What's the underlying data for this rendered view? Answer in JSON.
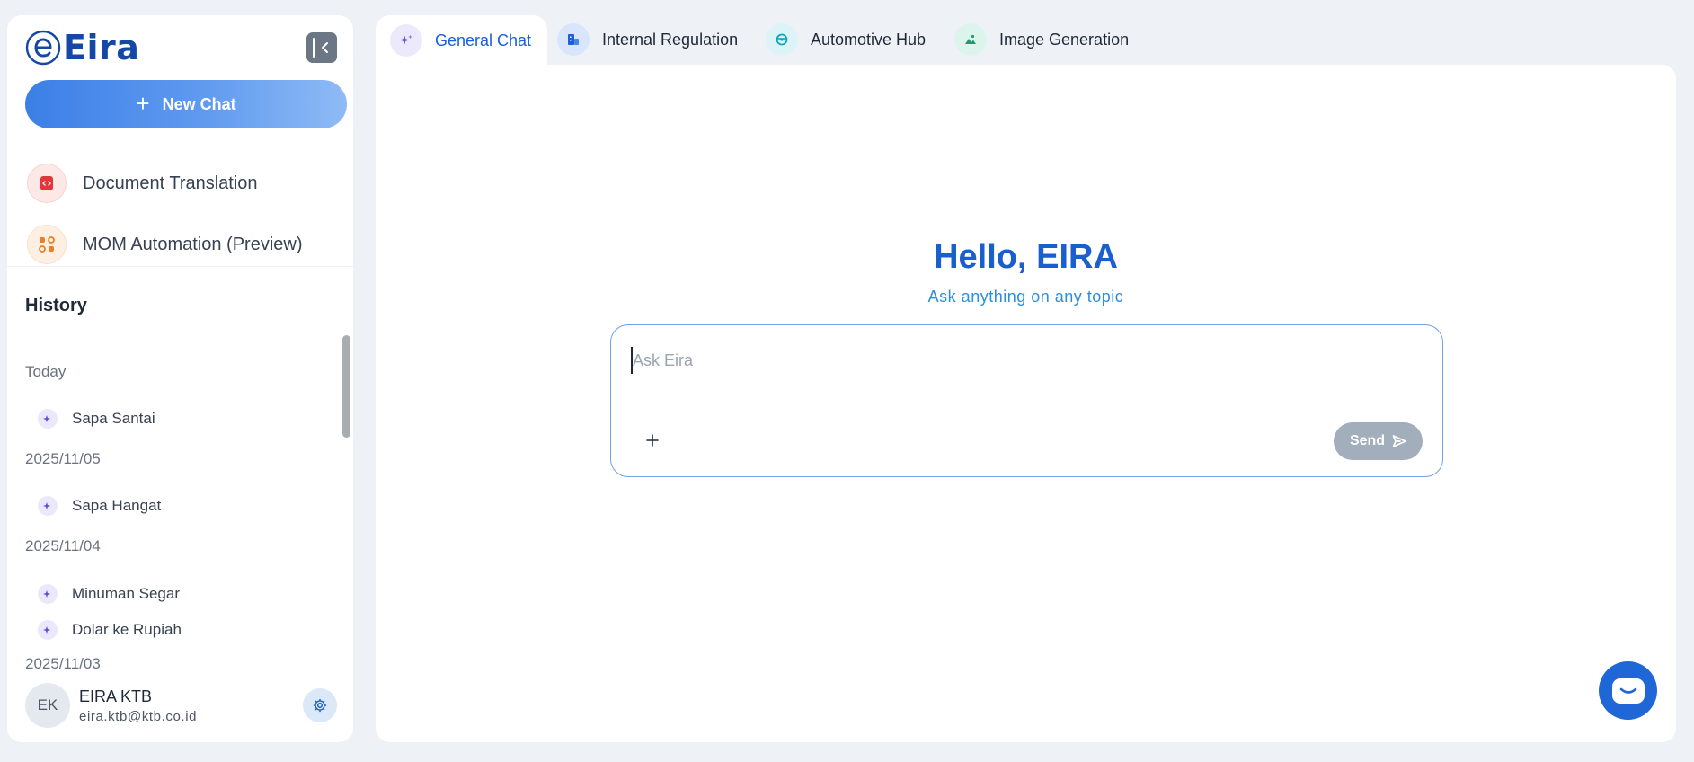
{
  "brand": {
    "logo_text": "Eira",
    "accent": "#1a5fcf"
  },
  "sidebar": {
    "collapse_icon": "chevron-left-icon",
    "new_chat_label": "New Chat",
    "tools": [
      {
        "label": "Document Translation",
        "icon": "document-code-icon"
      },
      {
        "label": "MOM Automation (Preview)",
        "icon": "automation-icon"
      }
    ],
    "history_title": "History",
    "history": {
      "groups": [
        {
          "label": "Today",
          "items": [
            "Sapa Santai"
          ]
        },
        {
          "label": "2025/11/05",
          "items": [
            "Sapa Hangat"
          ]
        },
        {
          "label": "2025/11/04",
          "items": [
            "Minuman Segar",
            "Dolar ke Rupiah"
          ]
        },
        {
          "label": "2025/11/03",
          "items": []
        }
      ]
    },
    "user": {
      "initials": "EK",
      "name": "EIRA KTB",
      "email": "eira.ktb@ktb.co.id"
    }
  },
  "tabs": [
    {
      "label": "General Chat",
      "active": true,
      "icon": "sparkle-icon"
    },
    {
      "label": "Internal Regulation",
      "active": false,
      "icon": "building-icon"
    },
    {
      "label": "Automotive Hub",
      "active": false,
      "icon": "steering-wheel-icon"
    },
    {
      "label": "Image Generation",
      "active": false,
      "icon": "image-icon"
    }
  ],
  "main": {
    "greeting": "Hello, EIRA",
    "subtitle": "Ask anything on any topic",
    "input_placeholder": "Ask Eira",
    "input_value": "",
    "send_label": "Send"
  }
}
